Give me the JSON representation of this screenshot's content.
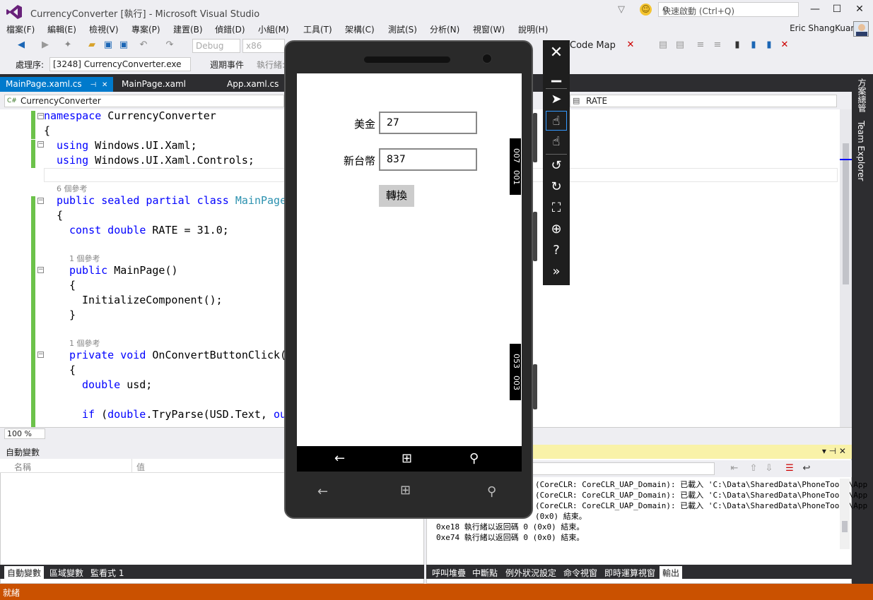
{
  "window": {
    "title": "CurrencyConverter [執行] - Microsoft Visual Studio",
    "quick_launch_placeholder": "快速啟動 (Ctrl+Q)"
  },
  "menu": [
    "檔案(F)",
    "編輯(E)",
    "檢視(V)",
    "專案(P)",
    "建置(B)",
    "偵錯(D)",
    "小組(M)",
    "工具(T)",
    "架構(C)",
    "測試(S)",
    "分析(N)",
    "視窗(W)",
    "說明(H)"
  ],
  "user": {
    "name": "Eric ShangKuan"
  },
  "toolbar": {
    "config": "Debug",
    "platform": "x86",
    "code_map": "Code Map",
    "process_label": "處理序:",
    "process_value": "[3248] CurrencyConverter.exe",
    "lifecycle": "週期事件",
    "thread_label": "執行緒:"
  },
  "doc_tabs": [
    "MainPage.xaml.cs",
    "MainPage.xaml",
    "App.xaml.cs"
  ],
  "nav": {
    "left": "CurrencyConverter",
    "right": "RATE"
  },
  "code": {
    "l1_kw": "namespace",
    "l1_rest": " CurrencyConverter",
    "l2": "{",
    "l3_kw": "using",
    "l3_rest": " Windows.UI.Xaml;",
    "l4_kw": "using",
    "l4_rest": " Windows.UI.Xaml.Controls;",
    "lens1": "6 個參考",
    "l6_kw": "public sealed partial class",
    "l6_type": "MainPage",
    "l7": "{",
    "l8_kw": "const double",
    "l8_rest": " RATE = 31.0;",
    "lens2": "1 個參考",
    "l10_kw": "public",
    "l10_rest": " MainPage()",
    "l11": "{",
    "l12": "InitializeComponent();",
    "l13": "}",
    "lens3": "1 個參考",
    "l15_kw": "private void",
    "l15_rest": " OnConvertButtonClick(",
    "l16": "{",
    "l17_kw": "double",
    "l17_rest": " usd;",
    "l19_kw": "if",
    "l19_rest": " (",
    "l19_kw2": "double",
    "l19_rest2": ".TryParse(USD.Text, ",
    "l19_kw3": "ou"
  },
  "zoom": "100 %",
  "right_tabs": [
    "方案總管",
    "Team Explorer"
  ],
  "autos": {
    "title": "自動變數",
    "col_name": "名稱",
    "col_value": "值",
    "tabs": [
      "自動變數",
      "區域變數",
      "監看式 1"
    ]
  },
  "output": {
    "lines": [
      "(CoreCLR: CoreCLR_UAP_Domain): 已載入 'C:\\Data\\SharedData\\PhoneTools\\App",
      "(CoreCLR: CoreCLR_UAP_Domain): 已載入 'C:\\Data\\SharedData\\PhoneTools\\App",
      "(CoreCLR: CoreCLR_UAP_Domain): 已載入 'C:\\Data\\SharedData\\PhoneTools\\App",
      "(0x0) 結束。",
      "0xe18 執行緒以返回碼 0 (0x0) 結束。",
      "0xe74 執行緒以返回碼 0 (0x0) 結束。"
    ],
    "tabs": [
      "呼叫堆疊",
      "中斷點",
      "例外狀況設定",
      "命令視窗",
      "即時運算視窗",
      "輸出"
    ]
  },
  "status": "就緒",
  "emulator": {
    "usd_label": "美金",
    "usd_value": "27",
    "twd_label": "新台幣",
    "twd_value": "837",
    "convert_label": "轉換",
    "ruler_top_a": "007",
    "ruler_top_b": "001",
    "ruler_bot_a": "053",
    "ruler_bot_b": "003"
  }
}
